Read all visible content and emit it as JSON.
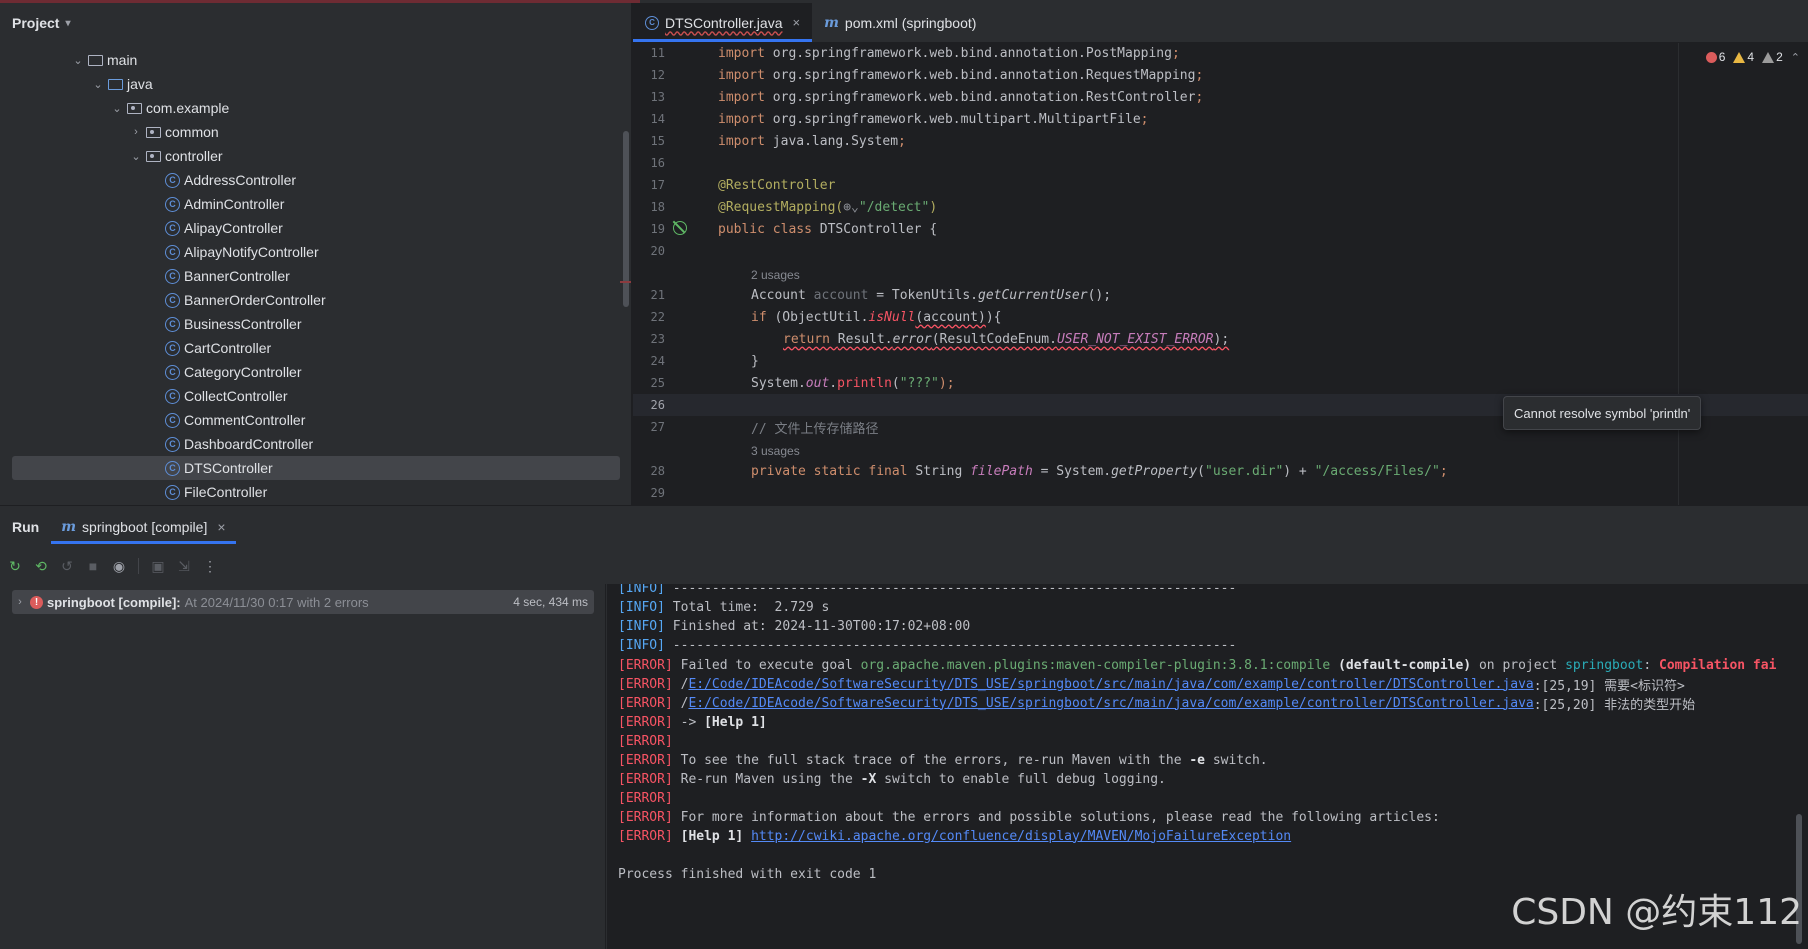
{
  "project": {
    "title": "Project",
    "tree": [
      {
        "label": "main",
        "kind": "folder",
        "expanded": true,
        "depth": 3
      },
      {
        "label": "java",
        "kind": "folder-blue",
        "expanded": true,
        "depth": 4
      },
      {
        "label": "com.example",
        "kind": "package",
        "expanded": true,
        "depth": 5
      },
      {
        "label": "common",
        "kind": "package",
        "expanded": false,
        "depth": 6
      },
      {
        "label": "controller",
        "kind": "package",
        "expanded": true,
        "depth": 6
      },
      {
        "label": "AddressController",
        "kind": "class",
        "depth": 7
      },
      {
        "label": "AdminController",
        "kind": "class",
        "depth": 7
      },
      {
        "label": "AlipayController",
        "kind": "class",
        "depth": 7
      },
      {
        "label": "AlipayNotifyController",
        "kind": "class",
        "depth": 7
      },
      {
        "label": "BannerController",
        "kind": "class",
        "depth": 7
      },
      {
        "label": "BannerOrderController",
        "kind": "class",
        "depth": 7
      },
      {
        "label": "BusinessController",
        "kind": "class",
        "depth": 7
      },
      {
        "label": "CartController",
        "kind": "class",
        "depth": 7
      },
      {
        "label": "CategoryController",
        "kind": "class",
        "depth": 7
      },
      {
        "label": "CollectController",
        "kind": "class",
        "depth": 7
      },
      {
        "label": "CommentController",
        "kind": "class",
        "depth": 7
      },
      {
        "label": "DashboardController",
        "kind": "class",
        "depth": 7
      },
      {
        "label": "DTSController",
        "kind": "class",
        "depth": 7,
        "selected": true
      },
      {
        "label": "FileController",
        "kind": "class",
        "depth": 7
      }
    ]
  },
  "editor": {
    "tabs": [
      {
        "label": "DTSController.java",
        "icon": "class-icon",
        "active": true
      },
      {
        "label": "pom.xml (springboot)",
        "icon": "maven-icon",
        "active": false
      }
    ],
    "inspections": {
      "errors": "6",
      "warnings": "4",
      "weak_warnings": "2"
    },
    "lines": {
      "l11": {
        "num": "11",
        "a": "import ",
        "b": "org.springframework.web.bind.annotation.PostMapping",
        "c": ";"
      },
      "l12": {
        "num": "12",
        "a": "import ",
        "b": "org.springframework.web.bind.annotation.RequestMapping",
        "c": ";"
      },
      "l13": {
        "num": "13",
        "a": "import ",
        "b": "org.springframework.web.bind.annotation.RestController",
        "c": ";"
      },
      "l14": {
        "num": "14",
        "a": "import ",
        "b": "org.springframework.web.multipart.MultipartFile",
        "c": ";"
      },
      "l15": {
        "num": "15",
        "a": "import ",
        "b": "java.lang.System",
        "c": ";"
      },
      "l16": {
        "num": "16"
      },
      "l17": {
        "num": "17",
        "a": "@RestController"
      },
      "l18": {
        "num": "18",
        "a": "@RequestMapping(",
        "b": "⊕⌄",
        "c": "\"/detect\"",
        "d": ")"
      },
      "l19": {
        "num": "19",
        "a": "public class ",
        "b": "DTSController {"
      },
      "l20": {
        "num": "20"
      },
      "hint21": "2 usages",
      "l21": {
        "num": "21",
        "a": "Account ",
        "b": "account",
        "c": " = TokenUtils.",
        "d": "getCurrentUser",
        "e": "();"
      },
      "l22": {
        "num": "22",
        "a": "if ",
        "b": "(ObjectUtil.",
        "c": "isNull",
        "d": "(account)",
        "e": "){"
      },
      "l23": {
        "num": "23",
        "a": "return ",
        "b": "Result.",
        "c": "error",
        "d": "(ResultCodeEnum.",
        "e": "USER_NOT_EXIST_ERROR",
        "f": ");"
      },
      "l24": {
        "num": "24",
        "a": "}"
      },
      "l25": {
        "num": "25",
        "a": "System.",
        "b": "out",
        "c": ".",
        "d": "println",
        "e": "(",
        "f": "\"???\"",
        "g": ");"
      },
      "l26": {
        "num": "26"
      },
      "l27": {
        "num": "27",
        "a": "// 文件上传存储路径"
      },
      "hint28": "3 usages",
      "l28": {
        "num": "28",
        "a": "private static final ",
        "b": "String ",
        "c": "filePath",
        "d": " = System.",
        "e": "getProperty",
        "f": "(",
        "g": "\"user.dir\"",
        "h": ") + ",
        "i": "\"/access/Files/\"",
        "j": ";"
      },
      "l29": {
        "num": "29"
      }
    },
    "tooltip": "Cannot resolve symbol 'println'"
  },
  "run": {
    "title": "Run",
    "tab_label": "springboot [compile]",
    "build": {
      "name": "springboot [compile]:",
      "desc": "At 2024/11/30 0:17 with 2 errors",
      "time": "4 sec, 434 ms"
    },
    "console": {
      "c1": {
        "tag": "[INFO]",
        "text": " ------------------------------------------------------------------------"
      },
      "c2": {
        "tag": "[INFO]",
        "text": " Total time:  2.729 s"
      },
      "c3": {
        "tag": "[INFO]",
        "text": " Finished at: 2024-11-30T00:17:02+08:00"
      },
      "c4": {
        "tag": "[INFO]",
        "text": " ------------------------------------------------------------------------"
      },
      "c5": {
        "tag": "[ERROR]",
        "a": " Failed to execute goal ",
        "b": "org.apache.maven.plugins:maven-compiler-plugin:3.8.1:compile",
        "c": " (default-compile)",
        "d": " on project ",
        "e": "springboot",
        "f": ": ",
        "g": "Compilation fai"
      },
      "c6": {
        "tag": "[ERROR]",
        "a": " /",
        "b": "E:/Code/IDEAcode/SoftwareSecurity/DTS_USE/springboot/src/main/java/com/example/controller/DTSController.java",
        "c": ":[25,19] 需要<标识符>"
      },
      "c7": {
        "tag": "[ERROR]",
        "a": " /",
        "b": "E:/Code/IDEAcode/SoftwareSecurity/DTS_USE/springboot/src/main/java/com/example/controller/DTSController.java",
        "c": ":[25,20] 非法的类型开始"
      },
      "c8": {
        "tag": "[ERROR]",
        "a": " -> ",
        "b": "[Help 1]"
      },
      "c9": {
        "tag": "[ERROR]"
      },
      "c10": {
        "tag": "[ERROR]",
        "a": " To see the full stack trace of the errors, re-run Maven with the ",
        "b": "-e",
        "c": " switch."
      },
      "c11": {
        "tag": "[ERROR]",
        "a": " Re-run Maven using the ",
        "b": "-X",
        "c": " switch to enable full debug logging."
      },
      "c12": {
        "tag": "[ERROR]"
      },
      "c13": {
        "tag": "[ERROR]",
        "a": " For more information about the errors and possible solutions, please read the following articles:"
      },
      "c14": {
        "tag": "[ERROR]",
        "a": " ",
        "b": "[Help 1]",
        "c": " ",
        "d": "http://cwiki.apache.org/confluence/display/MAVEN/MojoFailureException"
      },
      "c15": {
        "text": "Process finished with exit code 1"
      }
    }
  },
  "watermark": "CSDN @约束112",
  "colors": {
    "accent": "#3574f0",
    "error": "#f75464",
    "info": "#56a8f5"
  }
}
